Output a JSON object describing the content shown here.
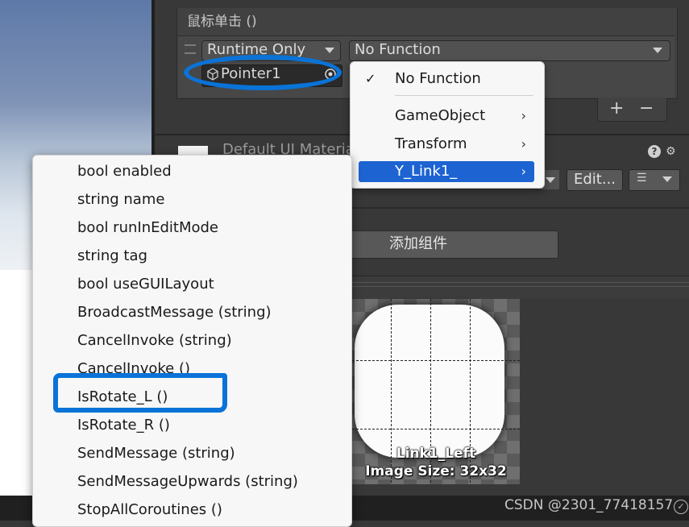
{
  "event": {
    "title": "鼠标单击 ()",
    "runtime_mode": "Runtime Only",
    "function": "No Function",
    "target_object": "Pointer1",
    "add_label": "+",
    "remove_label": "−"
  },
  "material": {
    "name": "Default UI Material",
    "edit_label": "Edit...",
    "add_component_label": "添加组件"
  },
  "preview": {
    "sprite_name": "Link1_Left",
    "image_size": "Image Size: 32x32"
  },
  "function_menu": {
    "no_function": "No Function",
    "items": [
      "GameObject",
      "Transform",
      "Y_Link1_"
    ],
    "selected": "Y_Link1_",
    "check_mark": "✓",
    "chevron": "›"
  },
  "method_menu": {
    "items": [
      "bool enabled",
      "string name",
      "bool runInEditMode",
      "string tag",
      "bool useGUILayout",
      "BroadcastMessage (string)",
      "CancelInvoke (string)",
      "CancelInvoke ()",
      "IsRotate_L ()",
      "IsRotate_R ()",
      "SendMessage (string)",
      "SendMessageUpwards (string)",
      "StopAllCoroutines ()"
    ],
    "highlighted": "IsRotate_L ()"
  },
  "watermark": "CSDN @2301_77418157",
  "colors": {
    "accent": "#1d63d2",
    "annotation": "#0a73d8",
    "panel_bg": "#383838",
    "menu_bg": "#f7f7f7"
  },
  "icons": {
    "object_icon": "cube-icon",
    "picker_icon": "target-icon",
    "help_icon": "?",
    "settings_icon": "⚙",
    "list_icon": "☰"
  }
}
